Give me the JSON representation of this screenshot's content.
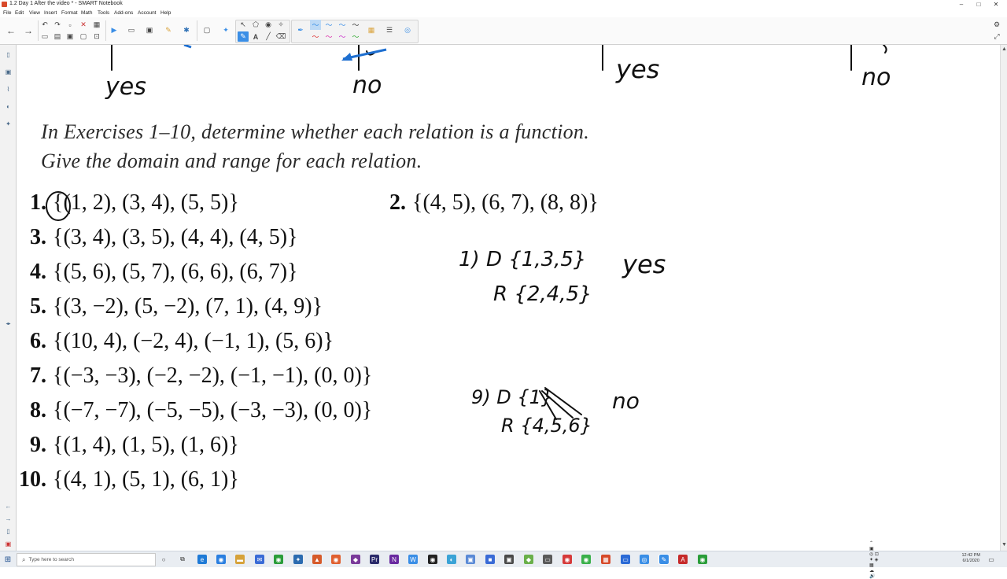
{
  "window": {
    "title": "1.2 Day 1 After the video * - SMART Notebook"
  },
  "menu": [
    "File",
    "Edit",
    "View",
    "Insert",
    "Format",
    "Math",
    "Tools",
    "Add-ons",
    "Account",
    "Help"
  ],
  "content": {
    "top_labels": [
      "yes",
      "no",
      "yes",
      "no"
    ],
    "instructions": [
      "In Exercises 1–10, determine whether each relation is a function.",
      "Give the domain and range for each relation."
    ],
    "exercises": [
      {
        "num": "1.",
        "set": "{(1, 2), (3, 4), (5, 5)}"
      },
      {
        "num": "2.",
        "set": "{(4, 5), (6, 7), (8, 8)}"
      },
      {
        "num": "3.",
        "set": "{(3, 4), (3, 5), (4, 4), (4, 5)}"
      },
      {
        "num": "4.",
        "set": "{(5, 6), (5, 7), (6, 6), (6, 7)}"
      },
      {
        "num": "5.",
        "set": "{(3, −2), (5, −2), (7, 1), (4, 9)}"
      },
      {
        "num": "6.",
        "set": "{(10, 4), (−2, 4), (−1, 1), (5, 6)}"
      },
      {
        "num": "7.",
        "set": "{(−3, −3), (−2, −2), (−1, −1), (0, 0)}"
      },
      {
        "num": "8.",
        "set": "{(−7, −7), (−5, −5), (−3, −3), (0, 0)}"
      },
      {
        "num": "9.",
        "set": "{(1, 4), (1, 5), (1, 6)}"
      },
      {
        "num": "10.",
        "set": "{(4, 1), (5, 1), (6, 1)}"
      }
    ],
    "handwriting": {
      "ans1_domain": "1) D {1,3,5}",
      "ans1_range": "R {2,4,5}",
      "ans1_verdict": "yes",
      "ans9_domain": "9) D {1}",
      "ans9_range": "R {4,5,6}",
      "ans9_verdict": "no"
    }
  },
  "taskbar": {
    "search_placeholder": "Type here to search",
    "time": "12:42 PM",
    "date": "6/1/2020"
  },
  "colors": {
    "accent": "#3a8ee6",
    "ink": "#111111",
    "toolbar": "#fafafa",
    "taskbar": "#e9edf2"
  },
  "icons": {
    "toolbar": [
      "back-arrow-icon",
      "forward-arrow-icon",
      "undo-icon",
      "redo-icon",
      "delete-icon",
      "table-icon",
      "screen-shade-icon",
      "measure-icon",
      "capture-icon",
      "pin-icon",
      "select-icon",
      "text-icon",
      "pen-icon",
      "eraser-icon",
      "line-icon",
      "fill-icon",
      "settings-icon"
    ]
  }
}
